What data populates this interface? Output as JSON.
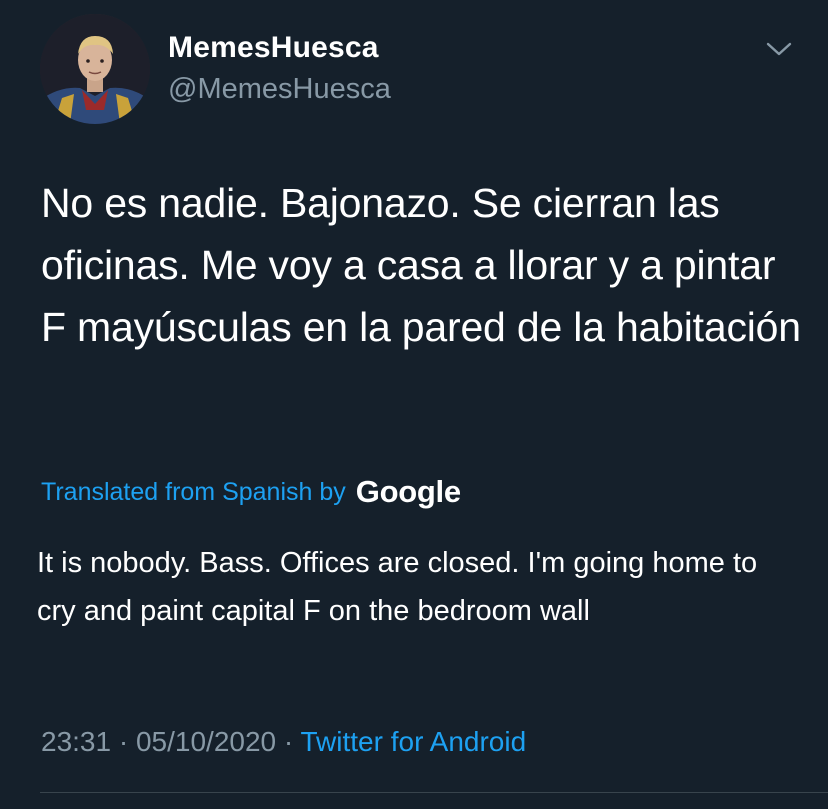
{
  "user": {
    "display_name": "MemesHuesca",
    "handle": "@MemesHuesca"
  },
  "tweet": {
    "original_text": "No es nadie. Bajonazo. Se cierran las oficinas. Me voy a casa a llorar y a pintar F mayúsculas en la pared de la habitación",
    "translation_label": "Translated from Spanish by",
    "translation_provider": "Google",
    "translated_text": "It is nobody. Bass. Offices are closed. I'm going home to cry and paint capital F on the bedroom wall",
    "time": "23:31",
    "date": "05/10/2020",
    "separator": " · ",
    "source": "Twitter for Android"
  },
  "icons": {
    "menu": "chevron-down-icon",
    "avatar": "avatar"
  },
  "colors": {
    "background": "#15202b",
    "text": "#ffffff",
    "secondary": "#8899a6",
    "link": "#1da1f2",
    "divider": "#38444d"
  }
}
